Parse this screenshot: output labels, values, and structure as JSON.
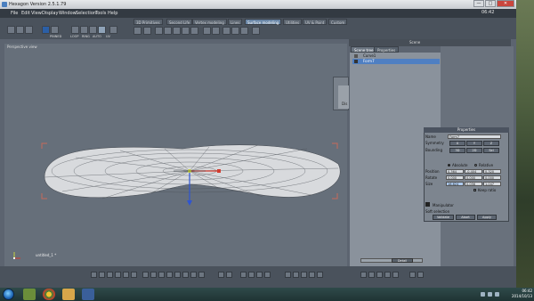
{
  "window": {
    "title": "Hexagon Version 2.5.1.79",
    "controls": [
      "—",
      "□",
      "✕"
    ]
  },
  "menu": [
    "File",
    "Edit",
    "View",
    "Display",
    "Window",
    "Selection",
    "Tools",
    "Help"
  ],
  "clock_top": "06:42",
  "tabs": [
    {
      "label": "3D Primitives",
      "active": false
    },
    {
      "label": "Second Life",
      "active": false
    },
    {
      "label": "Vertex modeling",
      "active": false
    },
    {
      "label": "Lines",
      "active": false
    },
    {
      "label": "Surface modeling",
      "active": true
    },
    {
      "label": "Utilities",
      "active": false
    },
    {
      "label": "UV & Paint",
      "active": false
    },
    {
      "label": "Custom",
      "active": false
    }
  ],
  "toolbar_labels": {
    "loop": "LOOP",
    "ring": "RING",
    "auto": "AUTO",
    "uv": "UV",
    "pinned": "PINNED"
  },
  "viewport": {
    "label": "Perspective view",
    "bottom_label": "untitled_1 *"
  },
  "scene": {
    "title": "Scene",
    "tabs": [
      {
        "label": "Scene tree",
        "active": true
      },
      {
        "label": "Properties",
        "active": false
      }
    ],
    "items": [
      {
        "label": "Curve1",
        "selected": false
      },
      {
        "label": "Form7",
        "selected": true
      }
    ],
    "small_pane_label": "Dis"
  },
  "properties": {
    "title": "Properties",
    "name_label": "Name",
    "name_value": "Form7",
    "symmetry_label": "Symmetry",
    "symmetry_axes": [
      "X",
      "Y",
      "Z"
    ],
    "bounding_label": "Bounding",
    "bounding_modes": [
      "3D",
      "2D",
      "Sel"
    ],
    "absolute_label": "Absolute",
    "relative_label": "Relative",
    "position_label": "Position",
    "rotate_label": "Rotate",
    "size_label": "Size",
    "position": [
      "0.364",
      "-0.404",
      "0.320"
    ],
    "rotate": [
      "0.000",
      "0.000",
      "0.000"
    ],
    "size": [
      "16.624",
      "0.056",
      "1.047"
    ],
    "keep_ratio": "Keep ratio",
    "manipulator": "Manipulator",
    "soft_selection": "Soft selection",
    "buttons": [
      "Validate",
      "Abort",
      "Apply"
    ]
  },
  "scene_bottom": {
    "button": "Detail"
  },
  "taskbar": {
    "time": "06:42",
    "date": "2014/10/13"
  },
  "colors": {
    "accent": "#4f7fc2",
    "viewport_bg": "#666f7a",
    "mesh": "#d8dadd",
    "axis_x": "#d23b2f",
    "axis_y": "#c7d23a",
    "axis_z": "#2f55d2"
  }
}
